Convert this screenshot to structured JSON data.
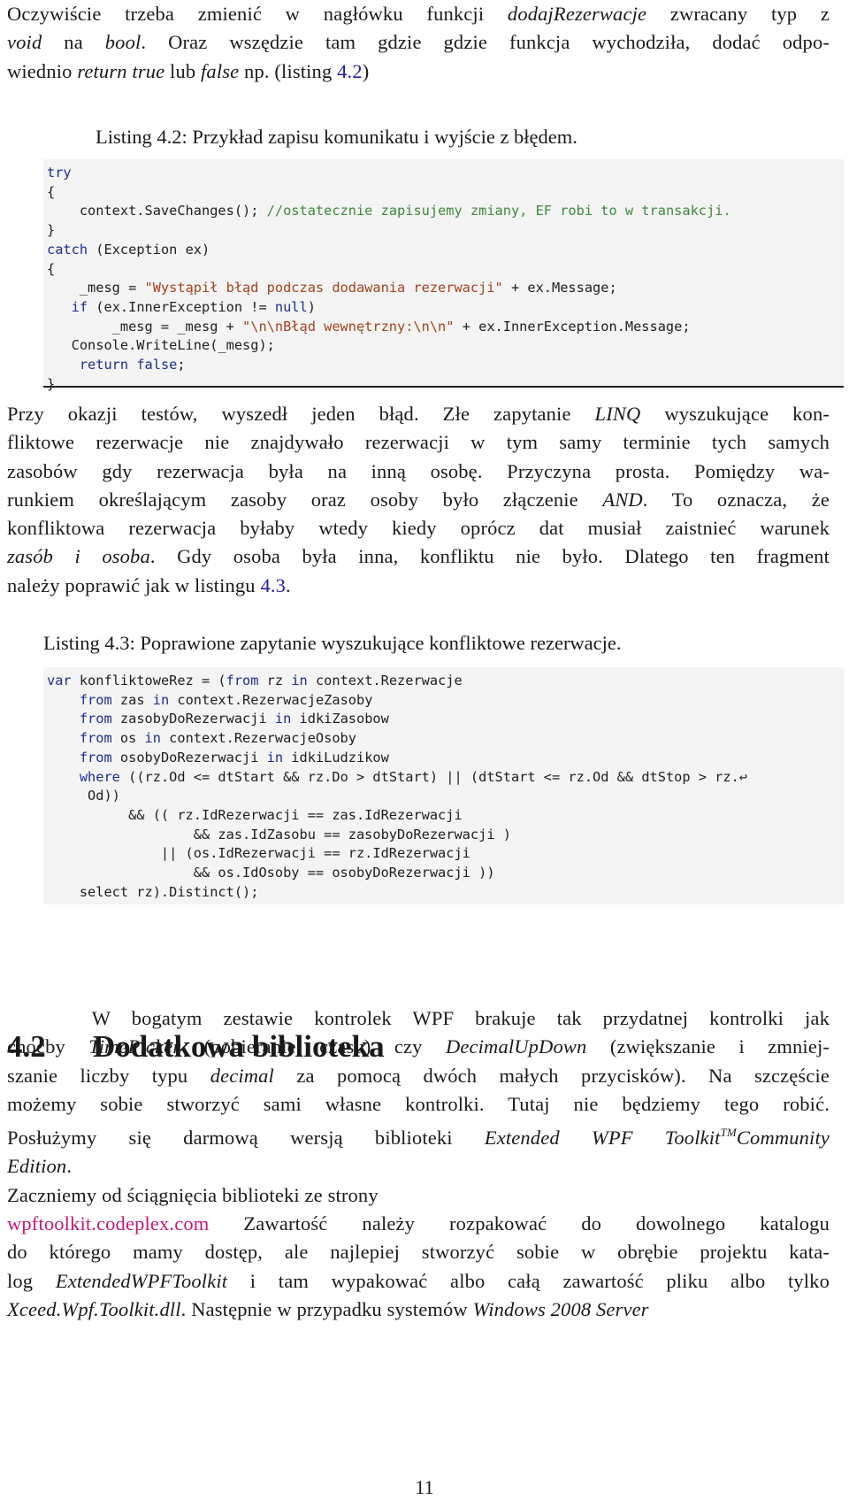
{
  "intro": {
    "lines": [
      [
        "Oczywiście trzeba zmienić w nagłówku funkcji ",
        {
          "i": "dodajRezerwacje"
        },
        " zwracany typ z"
      ],
      [
        {
          "i": "void"
        },
        " na ",
        {
          "i": "bool"
        },
        ". Oraz wszędzie tam gdzie gdzie funkcja wychodziła, dodać odpo-"
      ],
      [
        "wiednio ",
        {
          "i": "return true"
        },
        " lub ",
        {
          "i": "false"
        },
        " np. (listing ",
        {
          "ref": "4.2"
        },
        ")"
      ]
    ]
  },
  "listing_4_2": {
    "caption": "Listing 4.2: Przykład zapisu komunikatu i wyjście z błędem.",
    "code": [
      [
        {
          "k": "try"
        }
      ],
      [
        "{"
      ],
      [
        "    context.SaveChanges(); ",
        {
          "c": "//ostatecznie zapisujemy zmiany, EF robi to w transakcji."
        }
      ],
      [
        "}"
      ],
      [
        {
          "k": "catch"
        },
        " (Exception ex)"
      ],
      [
        "{"
      ],
      [
        "    _mesg = ",
        {
          "s": "\"Wystąpił błąd podczas dodawania rezerwacji\""
        },
        " + ex.Message;"
      ],
      [
        "   ",
        {
          "k": "if"
        },
        " (ex.InnerException != ",
        {
          "k": "null"
        },
        ")"
      ],
      [
        "        _mesg = _mesg + ",
        {
          "s": "\"\\n\\nBłąd wewnętrzny:\\n\\n\""
        },
        " + ex.InnerException.Message;"
      ],
      [
        "   Console.WriteLine(_mesg);"
      ],
      [
        "    ",
        {
          "k": "return"
        },
        " ",
        {
          "k": "false"
        },
        ";"
      ],
      [
        "}"
      ]
    ]
  },
  "paragraph_bug": {
    "lines": [
      [
        "Przy okazji testów, wyszedł jeden błąd. Złe zapytanie ",
        {
          "i": "LINQ"
        },
        " wyszukujące kon-"
      ],
      [
        "fliktowe rezerwacje nie znajdywało rezerwacji w tym samy terminie tych samych"
      ],
      [
        "zasobów gdy rezerwacja była na inną osobę. Przyczyna prosta. Pomiędzy wa-"
      ],
      [
        "runkiem określającym zasoby oraz osoby było złączenie ",
        {
          "i": "AND"
        },
        ". To oznacza, że"
      ],
      [
        "konfliktowa rezerwacja byłaby wtedy kiedy oprócz dat musiał zaistnieć warunek"
      ],
      [
        {
          "i": "zasób i osoba"
        },
        ". Gdy osoba była inna, konfliktu nie było. Dlatego ten fragment"
      ],
      [
        "należy poprawić jak w listingu ",
        {
          "ref": "4.3"
        },
        "."
      ]
    ]
  },
  "listing_4_3": {
    "caption": "Listing 4.3: Poprawione zapytanie wyszukujące konfliktowe rezerwacje.",
    "code": [
      [
        {
          "k": "var"
        },
        " konfliktoweRez = (",
        {
          "k": "from"
        },
        " rz ",
        {
          "k": "in"
        },
        " context.Rezerwacje"
      ],
      [
        "    ",
        {
          "k": "from"
        },
        " zas ",
        {
          "k": "in"
        },
        " context.RezerwacjeZasoby"
      ],
      [
        "    ",
        {
          "k": "from"
        },
        " zasobyDoRezerwacji ",
        {
          "k": "in"
        },
        " idkiZasobow"
      ],
      [
        "    ",
        {
          "k": "from"
        },
        " os ",
        {
          "k": "in"
        },
        " context.RezerwacjeOsoby"
      ],
      [
        "    ",
        {
          "k": "from"
        },
        " osobyDoRezerwacji ",
        {
          "k": "in"
        },
        " idkiLudzikow"
      ],
      [
        "    ",
        {
          "k": "where"
        },
        " ((rz.Od <= dtStart && rz.Do > dtStart) || (dtStart <= rz.Od && dtStop > rz.↩"
      ],
      [
        "     Od))"
      ],
      [
        "          && (( rz.IdRezerwacji == zas.IdRezerwacji"
      ],
      [
        "                  && zas.IdZasobu == zasobyDoRezerwacji )"
      ],
      [
        "              || (os.IdRezerwacji == rz.IdRezerwacji"
      ],
      [
        "                  && os.IdOsoby == osobyDoRezerwacji ))"
      ],
      [
        "    select rz).Distinct();"
      ]
    ]
  },
  "section": {
    "number": "4.2",
    "title": "Dodatkowa biblioteka"
  },
  "paragraph_library": {
    "lines": [
      [
        "    W bogatym zestawie kontrolek WPF brakuje tak przydatnej kontrolki jak"
      ],
      [
        "choćby ",
        {
          "i": "TimePicker"
        },
        " (pobieranie czasu) czy ",
        {
          "i": "DecimalUpDown"
        },
        " (zwiększanie i zmniej-"
      ],
      [
        "szanie liczby typu ",
        {
          "i": "decimal"
        },
        " za pomocą dwóch małych przycisków). Na szczęście"
      ],
      [
        "możemy sobie stworzyć sami własne kontrolki. Tutaj nie będziemy tego robić."
      ],
      [
        "Posłużymy się darmową wersją biblioteki ",
        {
          "i": "Extended WPF Toolkit"
        },
        {
          "tm": "TM"
        },
        {
          "i": "Community"
        }
      ],
      [
        {
          "i": "Edition"
        },
        ".",
        {
          "last": true
        }
      ],
      [
        "Zaczniemy od ściągnięcia biblioteki ze strony",
        {
          "last": true
        }
      ],
      [
        {
          "url": "wpftoolkit.codeplex.com"
        },
        " Zawartość należy rozpakować do dowolnego katalogu"
      ],
      [
        "do którego mamy dostęp, ale najlepiej stworzyć sobie w obrębie projektu kata-"
      ],
      [
        "log ",
        {
          "i": "ExtendedWPFToolkit"
        },
        " i tam wypakować albo całą zawartość pliku albo tylko"
      ],
      [
        {
          "i": "Xceed.Wpf.Toolkit.dll"
        },
        ". Następnie w przypadku systemów ",
        {
          "i": "Windows 2008 Server"
        }
      ]
    ]
  },
  "page_number": "11"
}
